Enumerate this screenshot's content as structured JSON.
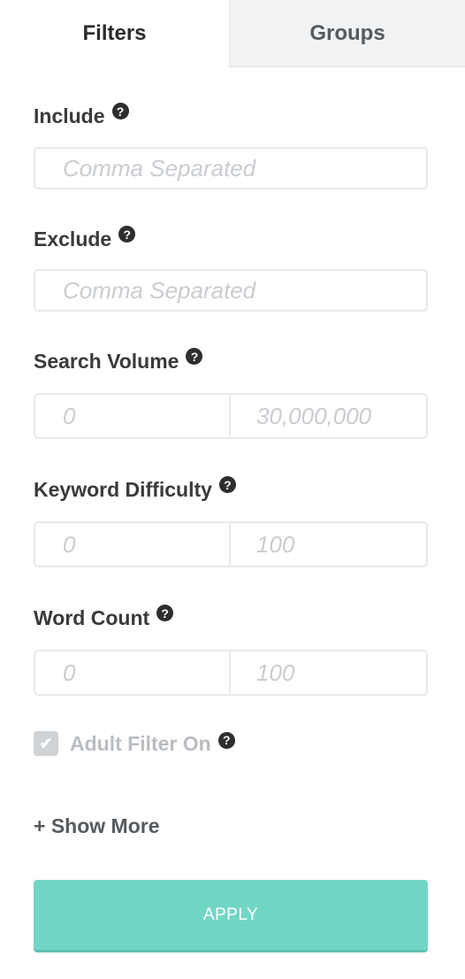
{
  "tabs": [
    {
      "label": "Filters",
      "active": true
    },
    {
      "label": "Groups",
      "active": false
    }
  ],
  "include": {
    "label": "Include",
    "placeholder": "Comma Separated",
    "value": ""
  },
  "exclude": {
    "label": "Exclude",
    "placeholder": "Comma Separated",
    "value": ""
  },
  "search_volume": {
    "label": "Search Volume",
    "min_placeholder": "0",
    "max_placeholder": "30,000,000"
  },
  "keyword_difficulty": {
    "label": "Keyword Difficulty",
    "min_placeholder": "0",
    "max_placeholder": "100"
  },
  "word_count": {
    "label": "Word Count",
    "min_placeholder": "0",
    "max_placeholder": "100"
  },
  "adult_filter": {
    "label": "Adult Filter On",
    "checked": true
  },
  "help_glyph": "?",
  "check_glyph": "✔",
  "show_more_label": "+ Show More",
  "apply_label": "APPLY",
  "colors": {
    "accent": "#71d7c4",
    "inactive_tab_bg": "#f1f2f3",
    "border": "#e7e9eb",
    "placeholder": "#c9cdd1"
  }
}
